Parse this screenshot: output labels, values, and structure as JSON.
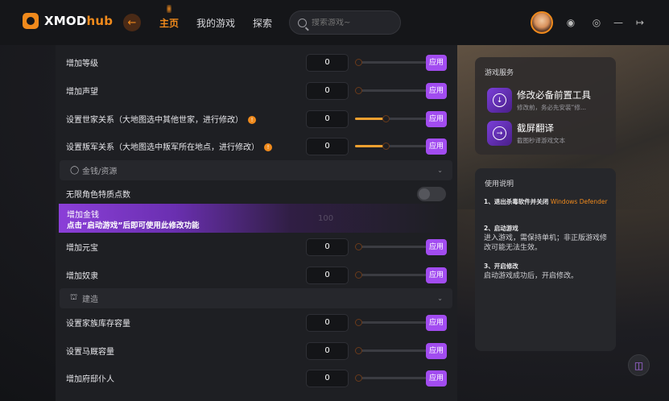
{
  "app": {
    "brand_main": "XMOD",
    "brand_hub": "hub"
  },
  "nav": {
    "back_icon": "arrow-left-icon",
    "items": [
      "主页",
      "我的游戏",
      "探索"
    ]
  },
  "search": {
    "placeholder": "搜索游戏~"
  },
  "colors": {
    "accent": "#f08a1c",
    "apply": "#a24cf0",
    "panel": "#1e1f23"
  },
  "rows_top": [
    {
      "label": "增加等级",
      "value": "0",
      "apply": "应用"
    },
    {
      "label": "增加声望",
      "value": "0",
      "apply": "应用"
    },
    {
      "label": "设置世家关系（大地图选中其他世家，进行修改）",
      "value": "0",
      "apply": "应用",
      "warn": "!"
    },
    {
      "label": "设置叛军关系（大地图选中叛军所在地点，进行修改）",
      "value": "0",
      "apply": "应用",
      "warn": "!"
    }
  ],
  "section_money": {
    "title": "金钱/资源",
    "icon": "money-bag-icon"
  },
  "toggle_row": {
    "label": "无限角色特质点数",
    "state": "off"
  },
  "promo": {
    "title": "增加金钱",
    "subtitle": "点击“启动游戏”后即可使用此修改功能",
    "ghost_value": "100"
  },
  "rows_mid": [
    {
      "label": "增加元宝",
      "value": "0",
      "apply": "应用"
    },
    {
      "label": "增加奴隶",
      "value": "0",
      "apply": "应用"
    }
  ],
  "section_build": {
    "title": "建造",
    "icon": "building-icon"
  },
  "rows_bottom": [
    {
      "label": "设置家族库存容量",
      "value": "0",
      "apply": "应用"
    },
    {
      "label": "设置马厩容量",
      "value": "0",
      "apply": "应用"
    },
    {
      "label": "增加府邸仆人",
      "value": "0",
      "apply": "应用"
    }
  ],
  "services": {
    "heading": "游戏服务",
    "items": [
      {
        "title": "修改必备前置工具",
        "desc": "修改前，务必先安装“修..."
      },
      {
        "title": "截屏翻译",
        "desc": "截图秒译游戏文本"
      }
    ]
  },
  "guide": {
    "heading": "使用说明",
    "steps": [
      {
        "title": "1、退出杀毒软件并关闭",
        "highlight": "Windows Defender",
        "body": ""
      },
      {
        "title": "2、启动游戏",
        "highlight": "",
        "body": "进入游戏，需保持单机；非正版游戏修改可能无法生效。"
      },
      {
        "title": "3、开启修改",
        "highlight": "",
        "body": "启动游戏成功后，开启修改。"
      }
    ]
  }
}
